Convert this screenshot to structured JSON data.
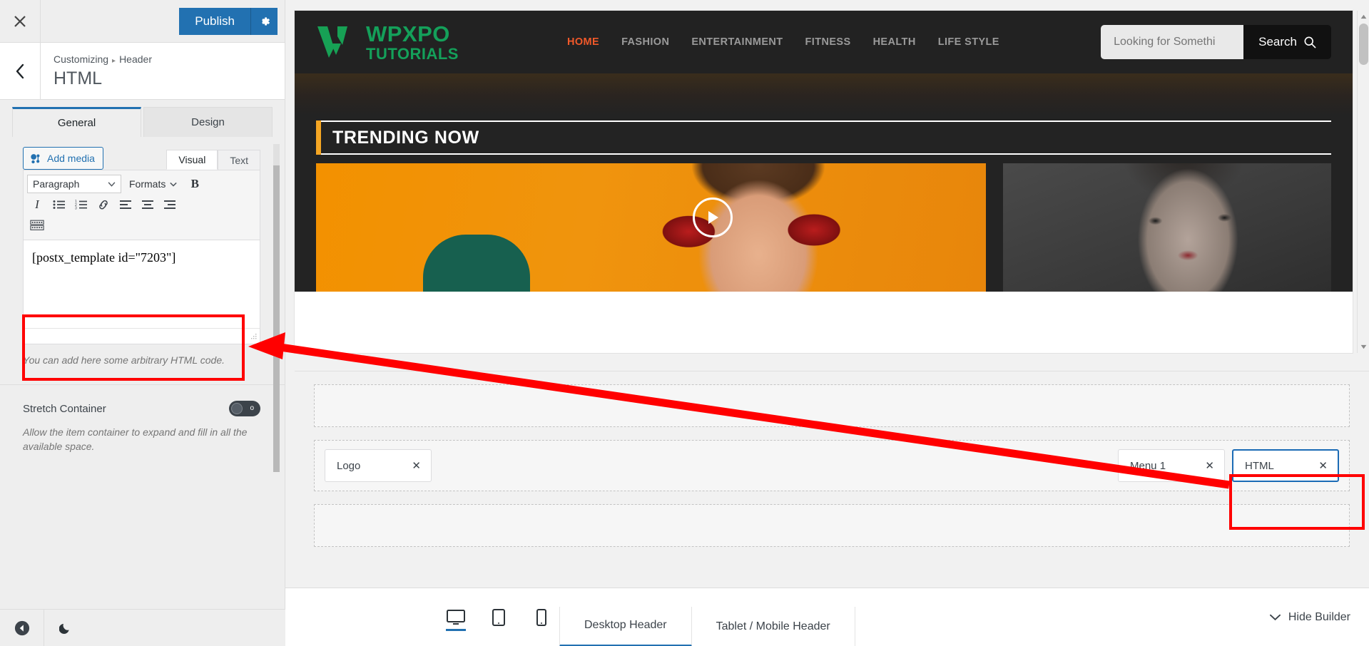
{
  "customizer": {
    "topbar": {
      "close_icon": "close-icon",
      "publish_label": "Publish",
      "gear_icon": "gear-icon"
    },
    "back_icon": "chevron-left-icon",
    "breadcrumb": {
      "root": "Customizing",
      "separator": "▸",
      "section": "Header"
    },
    "panel_title": "HTML",
    "tabs": [
      {
        "label": "General",
        "active": true
      },
      {
        "label": "Design",
        "active": false
      }
    ],
    "editor": {
      "add_media_label": "Add media",
      "add_media_icon": "media-icon",
      "mode_tabs": [
        {
          "label": "Visual",
          "active": true
        },
        {
          "label": "Text",
          "active": false
        }
      ],
      "paragraph_select": "Paragraph",
      "formats_label": "Formats",
      "toolbar_icons": [
        "bold-icon",
        "italic-icon",
        "bulleted-list-icon",
        "numbered-list-icon",
        "link-icon",
        "align-left-icon",
        "align-center-icon",
        "align-right-icon",
        "keyboard-shortcuts-icon"
      ],
      "content": "[postx_template id=\"7203\"]",
      "description": "You can add here some arbitrary HTML code."
    },
    "stretch": {
      "label": "Stretch Container",
      "toggle_state": "off",
      "toggle_off_glyph": "o",
      "description": "Allow the item container to expand and fill in all the available space."
    },
    "footer": {
      "prev_icon": "play-back-icon",
      "theme_icon": "moon-icon"
    }
  },
  "preview": {
    "site": {
      "logo": {
        "top": "WPXPO",
        "bottom": "TUTORIALS",
        "mark_icon": "wpxpo-w-logo-icon",
        "color": "#14a05a"
      },
      "nav": [
        {
          "label": "HOME",
          "active": true
        },
        {
          "label": "FASHION",
          "active": false
        },
        {
          "label": "ENTERTAINMENT",
          "active": false
        },
        {
          "label": "FITNESS",
          "active": false
        },
        {
          "label": "HEALTH",
          "active": false
        },
        {
          "label": "LIFE STYLE",
          "active": false
        }
      ],
      "search": {
        "placeholder": "Looking for Somethi",
        "button_label": "Search",
        "button_icon": "search-icon"
      },
      "trending": {
        "title": "TRENDING NOW",
        "accent_color": "#f5a623"
      },
      "cards": {
        "big": {
          "play_icon": "play-icon"
        },
        "small": {}
      }
    },
    "builder": {
      "rows": [
        {
          "name": "top-row",
          "items": []
        },
        {
          "name": "main-row",
          "left_items": [
            {
              "label": "Logo",
              "remove_icon": "close-icon",
              "selected": false
            }
          ],
          "right_items": [
            {
              "label": "Menu 1",
              "remove_icon": "close-icon",
              "selected": false
            },
            {
              "label": "HTML",
              "remove_icon": "close-icon",
              "selected": true
            }
          ]
        },
        {
          "name": "bottom-row",
          "items": []
        }
      ]
    },
    "devicebar": {
      "devices": [
        {
          "name": "desktop-icon",
          "active": true
        },
        {
          "name": "tablet-icon",
          "active": false
        },
        {
          "name": "mobile-icon",
          "active": false
        }
      ],
      "tabs": [
        {
          "label": "Desktop Header",
          "active": true
        },
        {
          "label": "Tablet / Mobile Header",
          "active": false
        }
      ],
      "hide_builder": {
        "label": "Hide Builder",
        "icon": "chevron-down-icon"
      }
    }
  },
  "annotations": {
    "highlight_color": "#ff0000",
    "boxes": [
      {
        "name": "shortcode-field-highlight"
      },
      {
        "name": "html-chip-highlight"
      }
    ],
    "arrow": {
      "name": "pointer-arrow",
      "from": "html-chip-highlight",
      "to": "shortcode-field-highlight"
    }
  }
}
